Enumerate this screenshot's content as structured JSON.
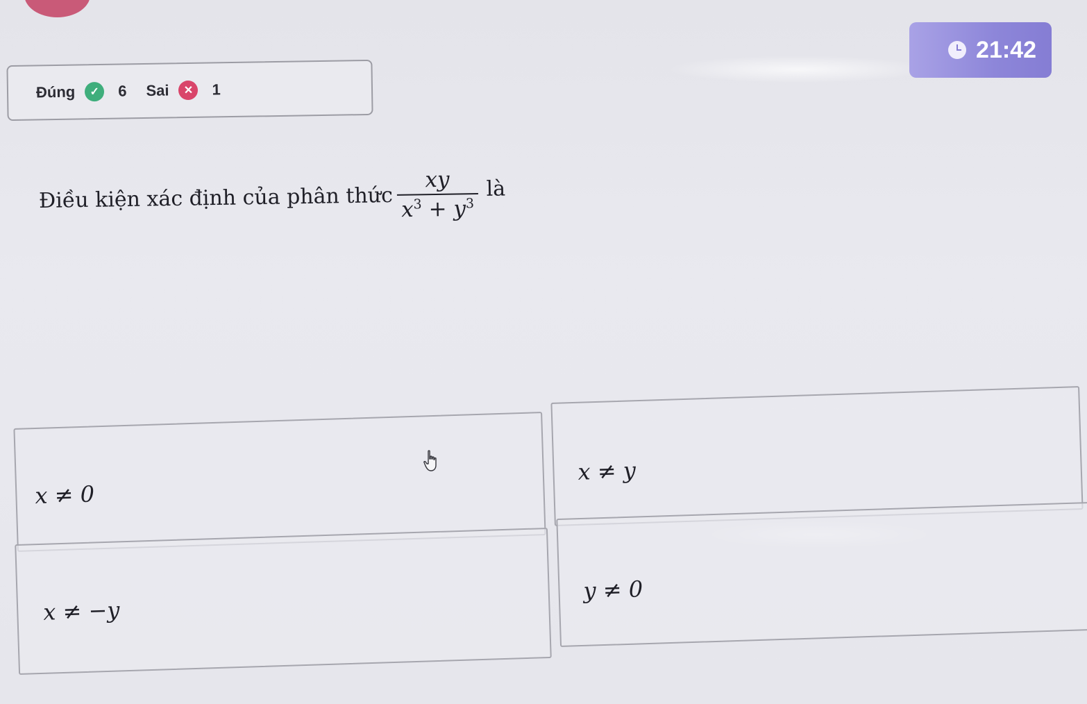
{
  "timer": {
    "time": "21:42",
    "icon": "clock-icon"
  },
  "score": {
    "correct_label": "Đúng",
    "correct_count": "6",
    "correct_icon": "check-circle-icon",
    "wrong_label": "Sai",
    "wrong_count": "1",
    "wrong_icon": "x-circle-icon"
  },
  "question": {
    "prefix": "Điều kiện xác định của phân thức",
    "fraction_num": "xy",
    "fraction_den_x": "x",
    "fraction_den_exp1": "3",
    "fraction_den_plus": " + ",
    "fraction_den_y": "y",
    "fraction_den_exp2": "3",
    "suffix": "là"
  },
  "answers": [
    {
      "math": "x ≠ 0"
    },
    {
      "math": "x ≠ y"
    },
    {
      "math": "x ≠ −y"
    },
    {
      "math": "y ≠ 0"
    }
  ],
  "colors": {
    "correct": "#3fae7c",
    "wrong": "#d9456a",
    "timer_bg": "#8d86d9",
    "avatar": "#c95a78"
  }
}
